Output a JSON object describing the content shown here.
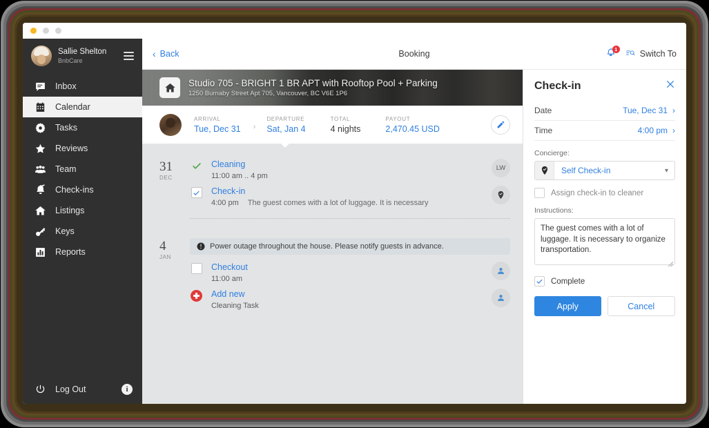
{
  "window": {
    "dots": [
      "amber",
      "grey",
      "grey"
    ]
  },
  "sidebar": {
    "user": {
      "name": "Sallie Shelton",
      "org": "BnbCare"
    },
    "items": [
      {
        "label": "Inbox",
        "icon": "inbox-icon",
        "active": false
      },
      {
        "label": "Calendar",
        "icon": "calendar-icon",
        "active": true
      },
      {
        "label": "Tasks",
        "icon": "tasks-icon",
        "active": false
      },
      {
        "label": "Reviews",
        "icon": "star-icon",
        "active": false
      },
      {
        "label": "Team",
        "icon": "team-icon",
        "active": false
      },
      {
        "label": "Check-ins",
        "icon": "bell-check-icon",
        "active": false
      },
      {
        "label": "Listings",
        "icon": "home-icon",
        "active": false
      },
      {
        "label": "Keys",
        "icon": "key-icon",
        "active": false
      },
      {
        "label": "Reports",
        "icon": "chart-icon",
        "active": false
      }
    ],
    "logout_label": "Log Out",
    "info_badge": "i"
  },
  "topbar": {
    "back_label": "Back",
    "title": "Booking",
    "notification_count": "1",
    "switch_label": "Switch To"
  },
  "hero": {
    "title": "Studio 705 - BRIGHT 1 BR APT with Rooftop Pool + Parking",
    "address": "1250 Burnaby Street Apt 705, Vancouver, BC V6E 1P6"
  },
  "summary": {
    "fields": [
      {
        "label": "ARRIVAL",
        "value": "Tue, Dec 31",
        "accent": true
      },
      {
        "label": "DEPARTURE",
        "value": "Sat, Jan 4",
        "accent": true
      },
      {
        "label": "TOTAL",
        "value": "4 nights",
        "accent": false
      },
      {
        "label": "PAYOUT",
        "value": "2,470.45 USD",
        "accent": true
      }
    ],
    "edit_icon": "pencil-icon"
  },
  "days": [
    {
      "num": "31",
      "month": "DEC",
      "notice": null,
      "tasks": [
        {
          "title": "Cleaning",
          "time": "11:00 am .. 4 pm",
          "note": "",
          "state": "tick",
          "badge_type": "initials",
          "badge_text": "LW"
        },
        {
          "title": "Check-in",
          "time": "4:00 pm",
          "note": "The guest comes with a lot of luggage. It is necessary",
          "state": "checked",
          "badge_type": "pin",
          "badge_text": ""
        }
      ]
    },
    {
      "num": "4",
      "month": "JAN",
      "notice": "Power outage throughout the house. Please notify guests in advance.",
      "tasks": [
        {
          "title": "Checkout",
          "time": "11:00 am",
          "note": "",
          "state": "empty",
          "badge_type": "user",
          "badge_text": ""
        },
        {
          "title": "Add new",
          "time": "Cleaning Task",
          "note": "",
          "state": "add",
          "badge_type": "user",
          "badge_text": ""
        }
      ]
    }
  ],
  "panel": {
    "title": "Check-in",
    "close_icon": "close-icon",
    "date_label": "Date",
    "date_value": "Tue, Dec 31",
    "time_label": "Time",
    "time_value": "4:00 pm",
    "concierge_label": "Concierge:",
    "concierge_value": "Self Check-in",
    "concierge_icon": "pin-check-icon",
    "assign_label": "Assign check-in to cleaner",
    "assign_checked": false,
    "instructions_label": "Instructions:",
    "instructions_value": "The guest comes with a lot of luggage. It is necessary to organize transportation.",
    "complete_label": "Complete",
    "complete_checked": true,
    "apply_label": "Apply",
    "cancel_label": "Cancel"
  },
  "colors": {
    "accent_blue": "#2e7fe0",
    "button_blue": "#2e86e0",
    "sidebar_dark": "#303030",
    "badge_red": "#e8343a",
    "tick_green": "#46a346",
    "add_red": "#e03a3a"
  }
}
